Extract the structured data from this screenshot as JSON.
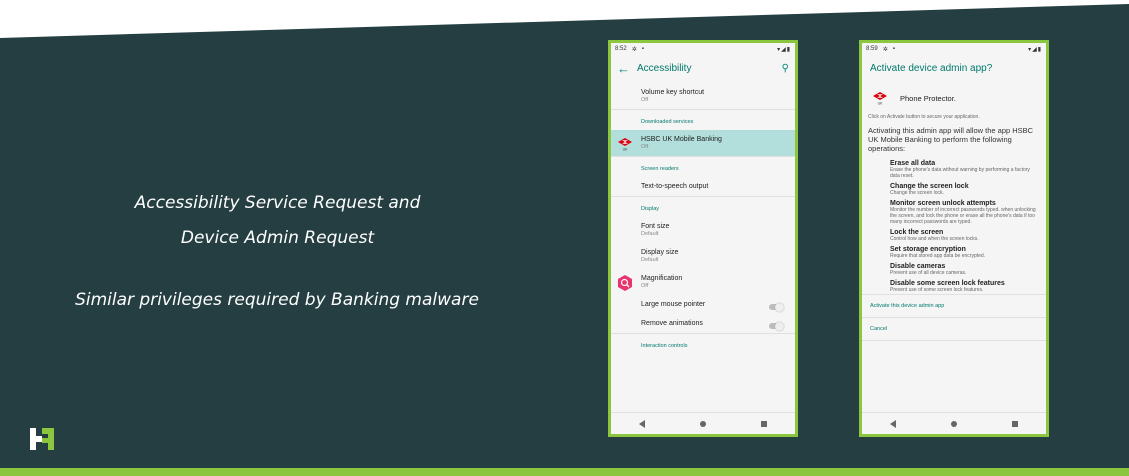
{
  "slide": {
    "captions": {
      "line1": "Accessibility Service Request and",
      "line2": "Device Admin Request",
      "line3": "Similar privileges required by Banking malware"
    },
    "colors": {
      "background": "#243e42",
      "accent": "#8cc63f"
    },
    "logo_icon": "brand-logo-icon"
  },
  "phone1": {
    "status": {
      "time": "8:52",
      "right": "▾◢▮"
    },
    "title": "Accessibility",
    "items": [
      {
        "title": "Volume key shortcut",
        "sub": "Off"
      }
    ],
    "section_downloaded": "Downloaded services",
    "hsbc": {
      "title": "HSBC UK Mobile Banking",
      "sub": "Off",
      "icon_label": "UK"
    },
    "section_readers": "Screen readers",
    "tts": {
      "title": "Text-to-speech output"
    },
    "section_display": "Display",
    "font_size": {
      "title": "Font size",
      "sub": "Default"
    },
    "display_size": {
      "title": "Display size",
      "sub": "Default"
    },
    "magnification": {
      "title": "Magnification",
      "sub": "Off"
    },
    "mouse": {
      "title": "Large mouse pointer"
    },
    "animations": {
      "title": "Remove animations"
    },
    "section_interaction": "Interaction controls"
  },
  "phone2": {
    "status": {
      "time": "8:59",
      "right": "▾◢▮"
    },
    "title": "Activate device admin app?",
    "app_name": "Phone Protector.",
    "app_icon_label": "UK",
    "hint": "Click on Activate button to secure your application.",
    "intro": "Activating this admin app will allow the app HSBC UK Mobile Banking to perform the following operations:",
    "permissions": [
      {
        "title": "Erase all data",
        "desc": "Erase the phone's data without warning by performing a factory data reset."
      },
      {
        "title": "Change the screen lock",
        "desc": "Change the screen lock."
      },
      {
        "title": "Monitor screen unlock attempts",
        "desc": "Monitor the number of incorrect passwords typed. when unlocking the screen, and lock the phone or erase all the phone's data if too many incorrect passwords are typed."
      },
      {
        "title": "Lock the screen",
        "desc": "Control how and when the screen locks."
      },
      {
        "title": "Set storage encryption",
        "desc": "Require that stored app data be encrypted."
      },
      {
        "title": "Disable cameras",
        "desc": "Prevent use of all device cameras."
      },
      {
        "title": "Disable some screen lock features",
        "desc": "Prevent use of some screen lock features."
      }
    ],
    "activate_label": "Activate this device admin app",
    "cancel_label": "Cancel"
  }
}
